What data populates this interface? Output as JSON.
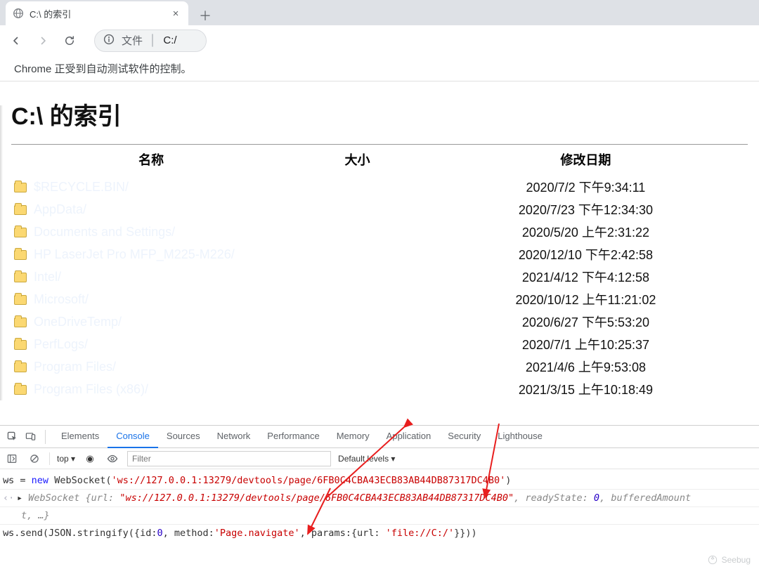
{
  "tab": {
    "title": "C:\\ 的索引"
  },
  "toolbar": {
    "info_label": "文件",
    "path": "C:/"
  },
  "infobar": {
    "text": "Chrome 正受到自动测试软件的控制。"
  },
  "page": {
    "title": "C:\\ 的索引",
    "headers": {
      "name": "名称",
      "size": "大小",
      "date": "修改日期"
    },
    "rows": [
      {
        "name": "$RECYCLE.BIN/",
        "date": "2020/7/2 下午9:34:11"
      },
      {
        "name": "AppData/",
        "date": "2020/7/23 下午12:34:30"
      },
      {
        "name": "Documents and Settings/",
        "date": "2020/5/20 上午2:31:22"
      },
      {
        "name": "HP LaserJet Pro MFP_M225-M226/",
        "date": "2020/12/10 下午2:42:58"
      },
      {
        "name": "Intel/",
        "date": "2021/4/12 下午4:12:58"
      },
      {
        "name": "Microsoft/",
        "date": "2020/10/12 上午11:21:02"
      },
      {
        "name": "OneDriveTemp/",
        "date": "2020/6/27 下午5:53:20"
      },
      {
        "name": "PerfLogs/",
        "date": "2020/7/1 上午10:25:37"
      },
      {
        "name": "Program Files/",
        "date": "2021/4/6 上午9:53:08"
      },
      {
        "name": "Program Files (x86)/",
        "date": "2021/3/15 上午10:18:49"
      }
    ]
  },
  "devtools": {
    "tabs": [
      "Elements",
      "Console",
      "Sources",
      "Network",
      "Performance",
      "Memory",
      "Application",
      "Security",
      "Lighthouse"
    ],
    "active_tab": "Console",
    "context": "top",
    "filter_placeholder": "Filter",
    "levels": "Default levels ▾",
    "line1": {
      "var": "ws",
      "kw": "new",
      "cls": "WebSocket",
      "str": "'ws://127.0.0.1:13279/devtools/page/6FB0C4CBA43ECB83AB44DB87317DC4B0'"
    },
    "line2": {
      "pre": "WebSocket {url: ",
      "url": "\"ws://127.0.0.1:13279/devtools/page/6FB0C4CBA43ECB83AB44DB87317DC4B0\"",
      "mid": ", readyState: ",
      "rs": "0",
      "post": ", bufferedAmount",
      "tail": "t, …}"
    },
    "line3": {
      "pre": "ws.send(JSON.stringify({id:",
      "id": "0",
      "m1": ", method:",
      "method": "'Page.navigate'",
      "m2": ", params:{url: ",
      "url": "'file://C:/'",
      "end": "}}))"
    }
  },
  "watermark": "Seebug"
}
